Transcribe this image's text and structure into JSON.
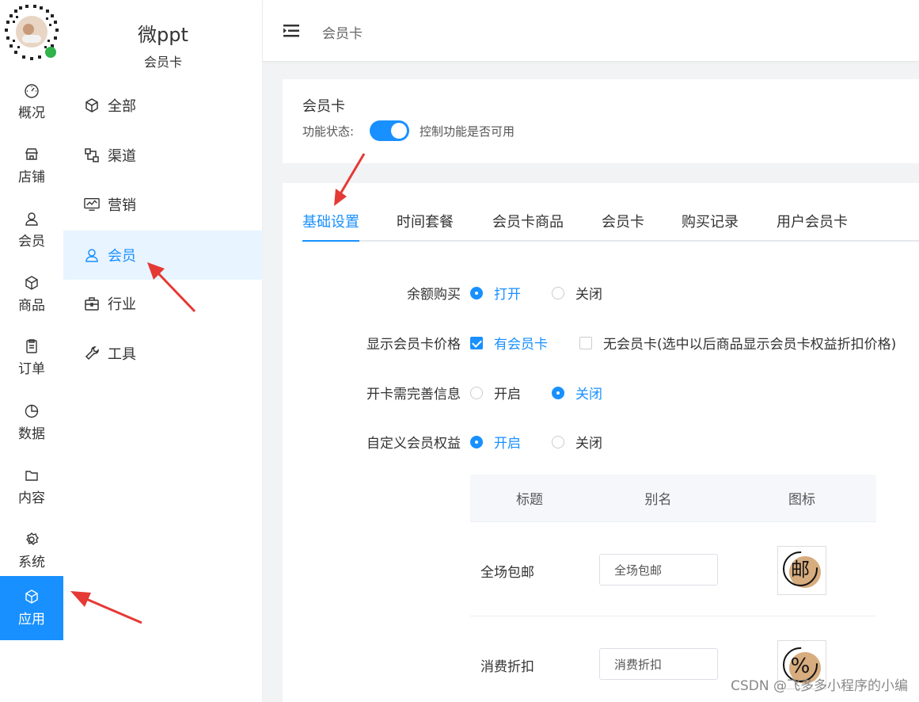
{
  "brand": {
    "name": "微ppt",
    "subtitle": "会员卡"
  },
  "rail": {
    "items": [
      {
        "label": "概况",
        "icon": "dashboard-icon"
      },
      {
        "label": "店铺",
        "icon": "store-icon"
      },
      {
        "label": "会员",
        "icon": "user-icon"
      },
      {
        "label": "商品",
        "icon": "box-icon"
      },
      {
        "label": "订单",
        "icon": "clipboard-icon"
      },
      {
        "label": "数据",
        "icon": "pie-chart-icon"
      },
      {
        "label": "内容",
        "icon": "folder-icon"
      },
      {
        "label": "系统",
        "icon": "gear-icon"
      },
      {
        "label": "应用",
        "icon": "cube-icon",
        "active": true
      }
    ]
  },
  "sidebar": {
    "items": [
      {
        "label": "全部",
        "icon": "cube-icon"
      },
      {
        "label": "渠道",
        "icon": "channel-icon"
      },
      {
        "label": "营销",
        "icon": "chart-monitor-icon"
      },
      {
        "label": "会员",
        "icon": "user-icon",
        "active": true
      },
      {
        "label": "行业",
        "icon": "briefcase-icon"
      },
      {
        "label": "工具",
        "icon": "wrench-icon"
      }
    ]
  },
  "header": {
    "breadcrumb": "会员卡"
  },
  "status_card": {
    "title": "会员卡",
    "status_label": "功能状态:",
    "status_desc": "控制功能是否可用",
    "enabled": true
  },
  "tabs": [
    "基础设置",
    "时间套餐",
    "会员卡商品",
    "会员卡",
    "购买记录",
    "用户会员卡"
  ],
  "form": {
    "balance_purchase": {
      "label": "余额购买",
      "opt1": "打开",
      "opt2": "关闭"
    },
    "show_price": {
      "label": "显示会员卡价格",
      "opt1": "有会员卡",
      "opt2": "无会员卡(选中以后商品显示会员卡权益折扣价格)"
    },
    "complete_info": {
      "label": "开卡需完善信息",
      "opt1": "开启",
      "opt2": "关闭"
    },
    "custom_rights": {
      "label": "自定义会员权益",
      "opt1": "开启",
      "opt2": "关闭"
    }
  },
  "rights_table": {
    "headers": [
      "标题",
      "别名",
      "图标"
    ],
    "rows": [
      {
        "title": "全场包邮",
        "alias": "全场包邮",
        "icon_text": "邮"
      },
      {
        "title": "消费折扣",
        "alias": "消费折扣",
        "icon_text": "%"
      }
    ]
  },
  "watermark": "CSDN @飞多多小程序的小编",
  "colors": {
    "accent": "#1890ff",
    "icon_fill": "#d7ac7e"
  }
}
